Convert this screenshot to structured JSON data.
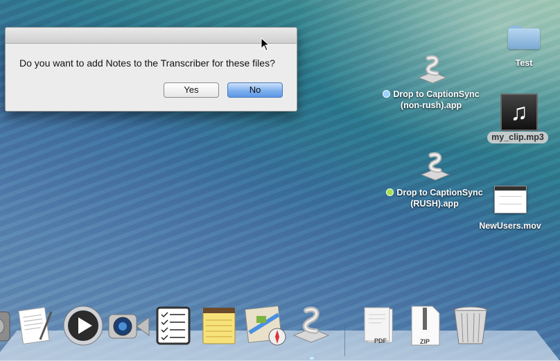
{
  "dialog": {
    "message": "Do you want to add Notes to the Transcriber for these files?",
    "yes_label": "Yes",
    "no_label": "No"
  },
  "desktop": {
    "items": [
      {
        "name": "Test",
        "icon": "folder-icon"
      },
      {
        "name": "my_clip.mp3",
        "icon": "music-file-icon"
      },
      {
        "name": "NewUsers.mov",
        "icon": "movie-file-icon"
      },
      {
        "line1": "Drop to CaptionSync",
        "line2": "(non-rush).app",
        "tag_color": "#9fd0ff",
        "icon": "captionsync-app-icon"
      },
      {
        "line1": "Drop to CaptionSync",
        "line2": "(RUSH).app",
        "tag_color": "#a6e04a",
        "icon": "captionsync-app-icon"
      }
    ]
  },
  "dock": {
    "items": [
      {
        "icon": "system-preferences-icon"
      },
      {
        "icon": "textedit-icon"
      },
      {
        "icon": "quicktime-player-icon"
      },
      {
        "icon": "facetime-icon"
      },
      {
        "icon": "reminders-icon"
      },
      {
        "icon": "notes-icon"
      },
      {
        "icon": "maps-icon"
      },
      {
        "icon": "captionsync-app-icon"
      },
      {
        "icon": "pdf-document-icon",
        "label": "PDF"
      },
      {
        "icon": "zip-archive-icon",
        "label": "ZIP"
      },
      {
        "icon": "trash-icon"
      }
    ]
  },
  "colors": {
    "default_button": "#7fb0ee",
    "dialog_background": "#ececec"
  }
}
